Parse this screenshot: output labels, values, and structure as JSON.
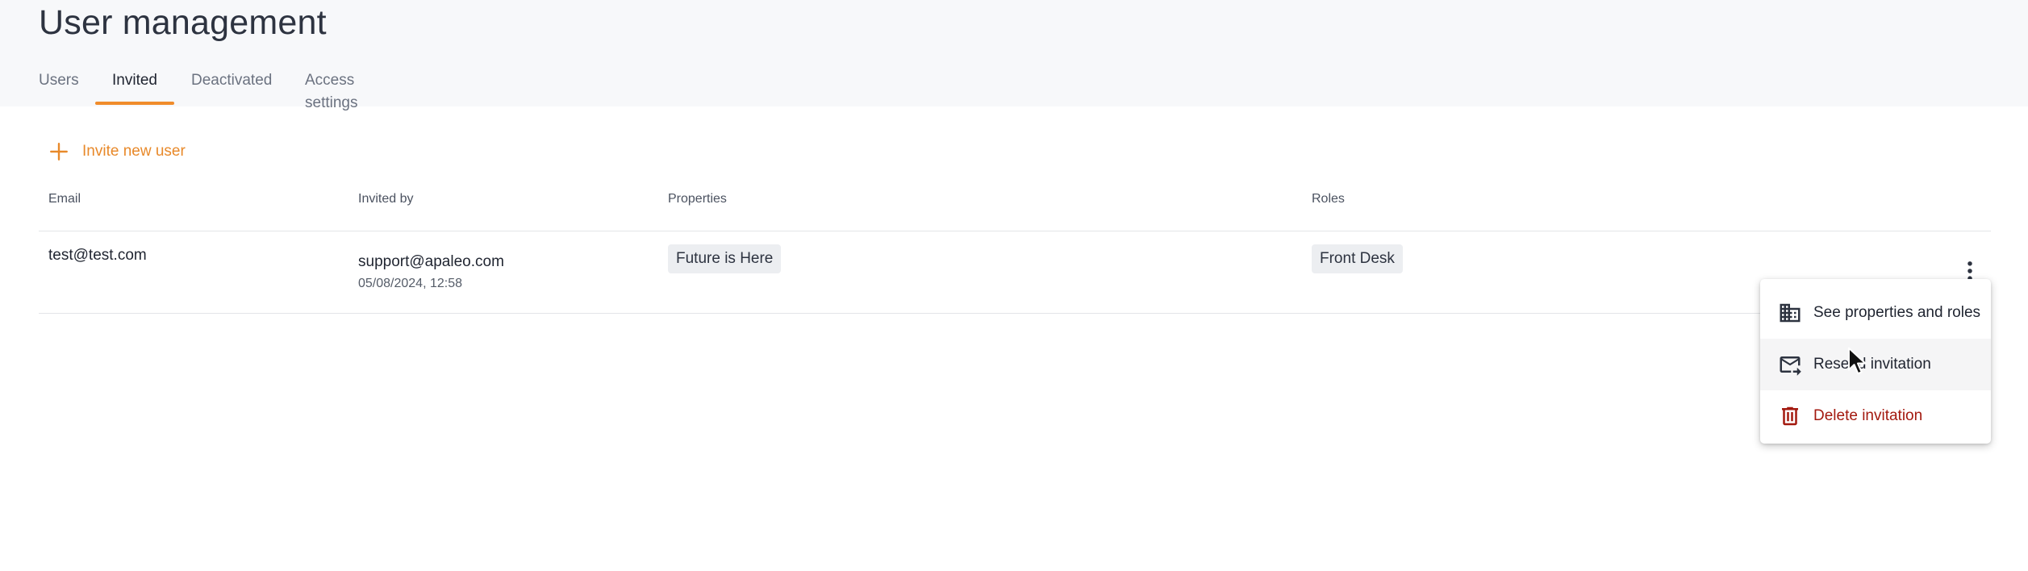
{
  "header": {
    "title": "User management",
    "tabs": [
      {
        "label": "Users"
      },
      {
        "label": "Invited"
      },
      {
        "label": "Deactivated"
      },
      {
        "label": "Access settings"
      }
    ],
    "active_tab": "Invited"
  },
  "actions": {
    "invite_label": "Invite new user",
    "invite_icon": "plus-icon"
  },
  "table": {
    "columns": [
      "Email",
      "Invited by",
      "Properties",
      "Roles"
    ],
    "rows": [
      {
        "email": "test@test.com",
        "invited_by": "support@apaleo.com",
        "invited_at": "05/08/2024, 12:58",
        "properties": [
          "Future is Here"
        ],
        "roles": [
          "Front Desk"
        ]
      }
    ]
  },
  "context_menu": {
    "items": [
      {
        "label": "See properties and roles",
        "icon": "building-icon"
      },
      {
        "label": "Resend invitation",
        "icon": "mail-forward-icon"
      },
      {
        "label": "Delete invitation",
        "icon": "trash-icon"
      }
    ]
  },
  "colors": {
    "accent": "#f08c2b",
    "danger": "#a3190f",
    "header_bg": "#f7f8fa",
    "chip_bg": "#eceef1"
  }
}
